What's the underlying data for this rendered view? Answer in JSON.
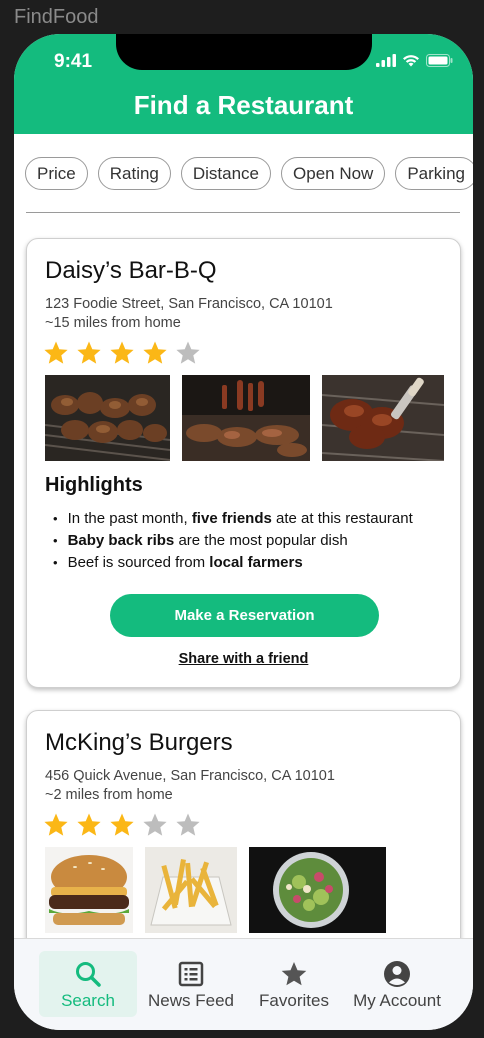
{
  "app_label": "FindFood",
  "status_bar": {
    "time": "9:41",
    "icons": [
      "signal-icon",
      "wifi-icon",
      "battery-icon"
    ]
  },
  "header": {
    "title": "Find a Restaurant"
  },
  "filters": [
    "Price",
    "Rating",
    "Distance",
    "Open Now",
    "Parking"
  ],
  "colors": {
    "accent": "#14bb7e",
    "star_filled": "#fbb716",
    "star_empty": "#bdbdbd"
  },
  "restaurants": [
    {
      "name": "Daisy’s Bar-B-Q",
      "address": "123 Foodie Street, San Francisco, CA 10101",
      "distance": "~15 miles from home",
      "rating": 4,
      "rating_max": 5,
      "photos": [
        "grilled-meat-skewers-photo",
        "bbq-pit-photo",
        "glazed-ribs-photo"
      ],
      "highlights_title": "Highlights",
      "highlights": [
        {
          "pre": "In the past month, ",
          "bold": "five friends",
          "post": " ate at this restaurant"
        },
        {
          "pre": "",
          "bold": "Baby back ribs",
          "post": " are the most popular dish"
        },
        {
          "pre": "Beef is sourced from ",
          "bold": "local farmers",
          "post": ""
        }
      ],
      "reserve_label": "Make a Reservation",
      "share_label": "Share with a friend"
    },
    {
      "name": "McKing’s Burgers",
      "address": "456 Quick Avenue, San Francisco, CA 10101",
      "distance": "~2 miles from home",
      "rating": 3,
      "rating_max": 5,
      "photos": [
        "burger-photo",
        "fries-photo",
        "salad-photo"
      ]
    }
  ],
  "bottom_nav": [
    {
      "label": "Search",
      "icon": "search-icon",
      "active": true
    },
    {
      "label": "News Feed",
      "icon": "news-feed-icon",
      "active": false
    },
    {
      "label": "Favorites",
      "icon": "star-icon",
      "active": false
    },
    {
      "label": "My Account",
      "icon": "account-icon",
      "active": false
    }
  ]
}
